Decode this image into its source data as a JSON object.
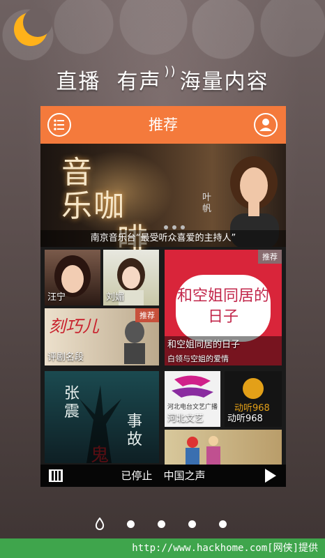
{
  "headline": {
    "part1": "直播",
    "part2": "有声",
    "part3": "海量内容"
  },
  "app": {
    "title": "推荐",
    "banner": {
      "art_text_1": "音",
      "art_text_2": "乐咖",
      "art_text_3": "啡",
      "signature": "叶帆",
      "caption": "南京音乐台“最受听众喜爱的主持人”"
    },
    "tiles": {
      "t1": "汪宁",
      "t2": "刘媚",
      "t3_tag": "推荐",
      "t3_title": "和空姐同居的日子",
      "t3_sub": "白领与空姐的爱情",
      "t3_art": "和空姐同居的日子",
      "t4_art": "刻巧儿",
      "t4_tag": "推荐",
      "t4": "评剧名段",
      "t5_art1": "张震",
      "t5_art2": "事故",
      "t5_art3": "鬼",
      "t6_small": "河北电台文艺广播",
      "t6": "河北文艺",
      "t7_art": "动听968",
      "t7": "动听968"
    },
    "player": {
      "status": "已停止",
      "station": "中国之声"
    }
  },
  "footer": {
    "text": "http://www.hackhome.com[网侠]提供"
  },
  "colors": {
    "accent": "#f47a3c",
    "footer": "#3fa54c"
  }
}
